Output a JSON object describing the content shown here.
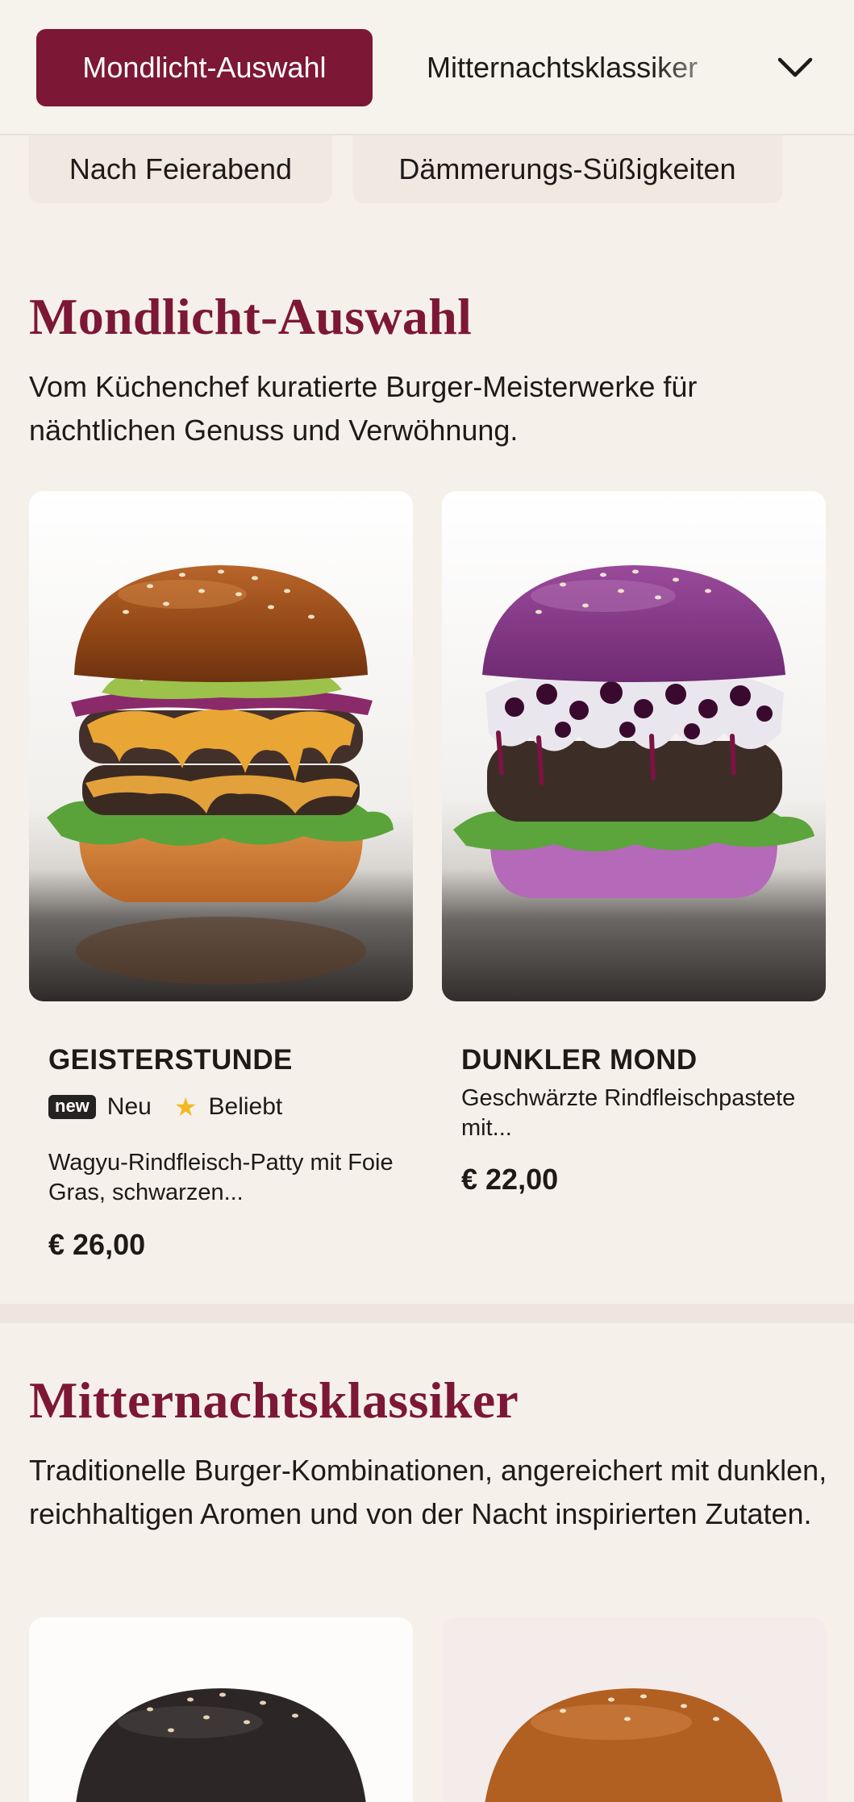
{
  "category_nav": {
    "active": "Mondlicht-Auswahl",
    "next": "Mitternachtsklassiker",
    "chips": [
      "Nach Feierabend",
      "Dämmerungs-Süßigkeiten"
    ]
  },
  "sections": [
    {
      "title": "Mondlicht-Auswahl",
      "description": "Vom Küchenchef kuratierte Burger-Meisterwerke für nächtlichen Genuss und Verwöhnung.",
      "items": [
        {
          "name": "GEISTERSTUNDE",
          "badge_new": "new",
          "badge_new_label": "Neu",
          "badge_popular_label": "Beliebt",
          "description": "Wagyu-Rindfleisch-Patty mit Foie Gras, schwarzen...",
          "price": "€ 26,00"
        },
        {
          "name": "DUNKLER MOND",
          "description": "Geschwärzte Rindfleischpastete mit...",
          "price": "€ 22,00"
        }
      ]
    },
    {
      "title": "Mitternachtsklassiker",
      "description": "Traditionelle Burger-Kombinationen, angereichert mit dunklen, reichhaltigen Aromen und von der Nacht inspirierten Zutaten."
    }
  ],
  "colors": {
    "accent": "#7d1736",
    "background": "#f5f1ea",
    "chip": "#efe9e2",
    "star": "#f2b824"
  },
  "icons": {
    "toggle": "chevron-down-icon",
    "popular": "star-icon"
  }
}
